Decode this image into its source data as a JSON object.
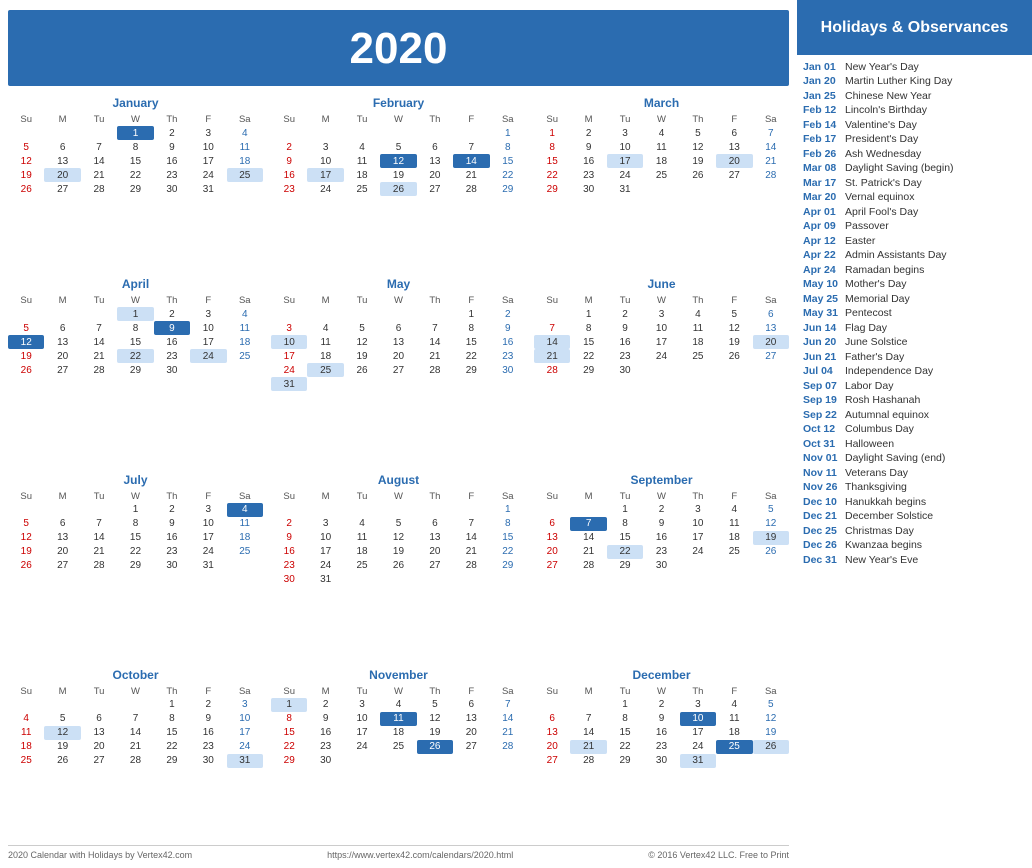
{
  "header": {
    "year": "2020",
    "title": "Holidays & Observances"
  },
  "footer": {
    "left": "2020 Calendar with Holidays by Vertex42.com",
    "center": "https://www.vertex42.com/calendars/2020.html",
    "right": "© 2016 Vertex42 LLC. Free to Print"
  },
  "months": [
    {
      "name": "January",
      "days_header": [
        "Su",
        "M",
        "Tu",
        "W",
        "Th",
        "F",
        "Sa"
      ],
      "weeks": [
        [
          null,
          null,
          null,
          1,
          2,
          3,
          4
        ],
        [
          5,
          6,
          7,
          8,
          9,
          10,
          11
        ],
        [
          12,
          13,
          14,
          15,
          16,
          17,
          18
        ],
        [
          19,
          20,
          21,
          22,
          23,
          24,
          25
        ],
        [
          26,
          27,
          28,
          29,
          30,
          31,
          null
        ]
      ],
      "highlights_blue": [
        1
      ],
      "highlights_light": [
        20,
        25
      ]
    },
    {
      "name": "February",
      "days_header": [
        "Su",
        "M",
        "Tu",
        "W",
        "Th",
        "F",
        "Sa"
      ],
      "weeks": [
        [
          null,
          null,
          null,
          null,
          null,
          null,
          1
        ],
        [
          2,
          3,
          4,
          5,
          6,
          7,
          8
        ],
        [
          9,
          10,
          11,
          12,
          13,
          14,
          15
        ],
        [
          16,
          17,
          18,
          19,
          20,
          21,
          22
        ],
        [
          23,
          24,
          25,
          26,
          27,
          28,
          29
        ]
      ],
      "highlights_blue": [
        12,
        14
      ],
      "highlights_light": [
        17,
        26
      ]
    },
    {
      "name": "March",
      "days_header": [
        "Su",
        "M",
        "Tu",
        "W",
        "Th",
        "F",
        "Sa"
      ],
      "weeks": [
        [
          1,
          2,
          3,
          4,
          5,
          6,
          7
        ],
        [
          8,
          9,
          10,
          11,
          12,
          13,
          14
        ],
        [
          15,
          16,
          17,
          18,
          19,
          20,
          21
        ],
        [
          22,
          23,
          24,
          25,
          26,
          27,
          28
        ],
        [
          29,
          30,
          31,
          null,
          null,
          null,
          null
        ]
      ],
      "highlights_blue": [],
      "highlights_light": [
        17,
        20
      ]
    },
    {
      "name": "April",
      "days_header": [
        "Su",
        "M",
        "Tu",
        "W",
        "Th",
        "F",
        "Sa"
      ],
      "weeks": [
        [
          null,
          null,
          null,
          1,
          2,
          3,
          4
        ],
        [
          5,
          6,
          7,
          8,
          9,
          10,
          11
        ],
        [
          12,
          13,
          14,
          15,
          16,
          17,
          18
        ],
        [
          19,
          20,
          21,
          22,
          23,
          24,
          25
        ],
        [
          26,
          27,
          28,
          29,
          30,
          null,
          null
        ]
      ],
      "highlights_blue": [
        9,
        12
      ],
      "highlights_light": [
        1,
        22,
        24
      ]
    },
    {
      "name": "May",
      "days_header": [
        "Su",
        "M",
        "Tu",
        "W",
        "Th",
        "F",
        "Sa"
      ],
      "weeks": [
        [
          null,
          null,
          null,
          null,
          null,
          1,
          2
        ],
        [
          3,
          4,
          5,
          6,
          7,
          8,
          9
        ],
        [
          10,
          11,
          12,
          13,
          14,
          15,
          16
        ],
        [
          17,
          18,
          19,
          20,
          21,
          22,
          23
        ],
        [
          24,
          25,
          26,
          27,
          28,
          29,
          30
        ],
        [
          31,
          null,
          null,
          null,
          null,
          null,
          null
        ]
      ],
      "highlights_blue": [],
      "highlights_light": [
        10,
        25,
        31
      ]
    },
    {
      "name": "June",
      "days_header": [
        "Su",
        "M",
        "Tu",
        "W",
        "Th",
        "F",
        "Sa"
      ],
      "weeks": [
        [
          null,
          1,
          2,
          3,
          4,
          5,
          6
        ],
        [
          7,
          8,
          9,
          10,
          11,
          12,
          13
        ],
        [
          14,
          15,
          16,
          17,
          18,
          19,
          20
        ],
        [
          21,
          22,
          23,
          24,
          25,
          26,
          27
        ],
        [
          28,
          29,
          30,
          null,
          null,
          null,
          null
        ]
      ],
      "highlights_blue": [],
      "highlights_light": [
        14,
        20,
        21
      ]
    },
    {
      "name": "July",
      "days_header": [
        "Su",
        "M",
        "Tu",
        "W",
        "Th",
        "F",
        "Sa"
      ],
      "weeks": [
        [
          null,
          null,
          null,
          1,
          2,
          3,
          4
        ],
        [
          5,
          6,
          7,
          8,
          9,
          10,
          11
        ],
        [
          12,
          13,
          14,
          15,
          16,
          17,
          18
        ],
        [
          19,
          20,
          21,
          22,
          23,
          24,
          25
        ],
        [
          26,
          27,
          28,
          29,
          30,
          31,
          null
        ]
      ],
      "highlights_blue": [
        4
      ],
      "highlights_light": []
    },
    {
      "name": "August",
      "days_header": [
        "Su",
        "M",
        "Tu",
        "W",
        "Th",
        "F",
        "Sa"
      ],
      "weeks": [
        [
          null,
          null,
          null,
          null,
          null,
          null,
          1
        ],
        [
          2,
          3,
          4,
          5,
          6,
          7,
          8
        ],
        [
          9,
          10,
          11,
          12,
          13,
          14,
          15
        ],
        [
          16,
          17,
          18,
          19,
          20,
          21,
          22
        ],
        [
          23,
          24,
          25,
          26,
          27,
          28,
          29
        ],
        [
          30,
          31,
          null,
          null,
          null,
          null,
          null
        ]
      ],
      "highlights_blue": [],
      "highlights_light": []
    },
    {
      "name": "September",
      "days_header": [
        "Su",
        "M",
        "Tu",
        "W",
        "Th",
        "F",
        "Sa"
      ],
      "weeks": [
        [
          null,
          null,
          1,
          2,
          3,
          4,
          5
        ],
        [
          6,
          7,
          8,
          9,
          10,
          11,
          12
        ],
        [
          13,
          14,
          15,
          16,
          17,
          18,
          19
        ],
        [
          20,
          21,
          22,
          23,
          24,
          25,
          26
        ],
        [
          27,
          28,
          29,
          30,
          null,
          null,
          null
        ]
      ],
      "highlights_blue": [
        7
      ],
      "highlights_light": [
        19,
        22
      ]
    },
    {
      "name": "October",
      "days_header": [
        "Su",
        "M",
        "Tu",
        "W",
        "Th",
        "F",
        "Sa"
      ],
      "weeks": [
        [
          null,
          null,
          null,
          null,
          1,
          2,
          3
        ],
        [
          4,
          5,
          6,
          7,
          8,
          9,
          10
        ],
        [
          11,
          12,
          13,
          14,
          15,
          16,
          17
        ],
        [
          18,
          19,
          20,
          21,
          22,
          23,
          24
        ],
        [
          25,
          26,
          27,
          28,
          29,
          30,
          31
        ]
      ],
      "highlights_blue": [],
      "highlights_light": [
        12,
        31
      ]
    },
    {
      "name": "November",
      "days_header": [
        "Su",
        "M",
        "Tu",
        "W",
        "Th",
        "F",
        "Sa"
      ],
      "weeks": [
        [
          1,
          2,
          3,
          4,
          5,
          6,
          7
        ],
        [
          8,
          9,
          10,
          11,
          12,
          13,
          14
        ],
        [
          15,
          16,
          17,
          18,
          19,
          20,
          21
        ],
        [
          22,
          23,
          24,
          25,
          26,
          27,
          28
        ],
        [
          29,
          30,
          null,
          null,
          null,
          null,
          null
        ]
      ],
      "highlights_blue": [
        11,
        26
      ],
      "highlights_light": [
        1
      ]
    },
    {
      "name": "December",
      "days_header": [
        "Su",
        "M",
        "Tu",
        "W",
        "Th",
        "F",
        "Sa"
      ],
      "weeks": [
        [
          null,
          null,
          1,
          2,
          3,
          4,
          5
        ],
        [
          6,
          7,
          8,
          9,
          10,
          11,
          12
        ],
        [
          13,
          14,
          15,
          16,
          17,
          18,
          19
        ],
        [
          20,
          21,
          22,
          23,
          24,
          25,
          26
        ],
        [
          27,
          28,
          29,
          30,
          31,
          null,
          null
        ]
      ],
      "highlights_blue": [
        10,
        25
      ],
      "highlights_light": [
        21,
        26,
        31
      ]
    }
  ],
  "holidays": [
    {
      "date": "Jan 01",
      "name": "New Year's Day"
    },
    {
      "date": "Jan 20",
      "name": "Martin Luther King Day"
    },
    {
      "date": "Jan 25",
      "name": "Chinese New Year"
    },
    {
      "date": "Feb 12",
      "name": "Lincoln's Birthday"
    },
    {
      "date": "Feb 14",
      "name": "Valentine's Day"
    },
    {
      "date": "Feb 17",
      "name": "President's Day"
    },
    {
      "date": "Feb 26",
      "name": "Ash Wednesday"
    },
    {
      "date": "Mar 08",
      "name": "Daylight Saving (begin)"
    },
    {
      "date": "Mar 17",
      "name": "St. Patrick's Day"
    },
    {
      "date": "Mar 20",
      "name": "Vernal equinox"
    },
    {
      "date": "Apr 01",
      "name": "April Fool's Day"
    },
    {
      "date": "Apr 09",
      "name": "Passover"
    },
    {
      "date": "Apr 12",
      "name": "Easter"
    },
    {
      "date": "Apr 22",
      "name": "Admin Assistants Day"
    },
    {
      "date": "Apr 24",
      "name": "Ramadan begins"
    },
    {
      "date": "May 10",
      "name": "Mother's Day"
    },
    {
      "date": "May 25",
      "name": "Memorial Day"
    },
    {
      "date": "May 31",
      "name": "Pentecost"
    },
    {
      "date": "Jun 14",
      "name": "Flag Day"
    },
    {
      "date": "Jun 20",
      "name": "June Solstice"
    },
    {
      "date": "Jun 21",
      "name": "Father's Day"
    },
    {
      "date": "Jul 04",
      "name": "Independence Day"
    },
    {
      "date": "Sep 07",
      "name": "Labor Day"
    },
    {
      "date": "Sep 19",
      "name": "Rosh Hashanah"
    },
    {
      "date": "Sep 22",
      "name": "Autumnal equinox"
    },
    {
      "date": "Oct 12",
      "name": "Columbus Day"
    },
    {
      "date": "Oct 31",
      "name": "Halloween"
    },
    {
      "date": "Nov 01",
      "name": "Daylight Saving (end)"
    },
    {
      "date": "Nov 11",
      "name": "Veterans Day"
    },
    {
      "date": "Nov 26",
      "name": "Thanksgiving"
    },
    {
      "date": "Dec 10",
      "name": "Hanukkah begins"
    },
    {
      "date": "Dec 21",
      "name": "December Solstice"
    },
    {
      "date": "Dec 25",
      "name": "Christmas Day"
    },
    {
      "date": "Dec 26",
      "name": "Kwanzaa begins"
    },
    {
      "date": "Dec 31",
      "name": "New Year's Eve"
    }
  ]
}
